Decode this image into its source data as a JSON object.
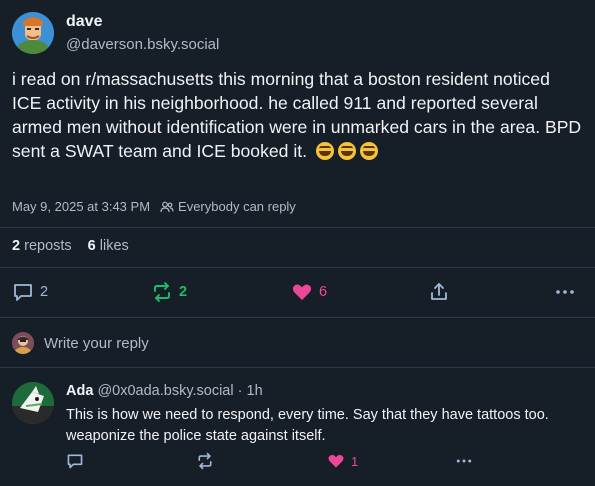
{
  "post": {
    "author_name": "dave",
    "author_handle": "@daverson.bsky.social",
    "text": "i read on r/massachusetts this morning that a boston resident noticed ICE activity in his neighborhood. he called 911 and reported several armed men without identification were in unmarked cars in the area. BPD sent a SWAT team and ICE booked it.",
    "emojis": [
      "rolling-on-floor-laughing",
      "rolling-on-floor-laughing",
      "rolling-on-floor-laughing"
    ],
    "timestamp": "May 9, 2025 at 3:43 PM",
    "reply_setting": "Everybody can reply",
    "reposts_count": "2",
    "reposts_label": "reposts",
    "likes_count": "6",
    "likes_label": "likes",
    "actions": {
      "reply_count": "2",
      "repost_count": "2",
      "like_count": "6"
    }
  },
  "reply_composer": {
    "placeholder": "Write your reply"
  },
  "comment": {
    "author_name": "Ada",
    "author_handle": "@0x0ada.bsky.social",
    "separator": "·",
    "age": "1h",
    "text": "This is how we need to respond, every time. Say that they have tattoos too. weaponize the police state against itself.",
    "actions": {
      "like_count": "1"
    }
  },
  "colors": {
    "background": "#161e27",
    "divider": "#2e3a48",
    "muted_text": "#aebbc9",
    "repost_green": "#20bc63",
    "like_pink": "#ec4899",
    "icon_blue": "#9fb9d9"
  },
  "icons": {
    "reply": "speech-bubble-icon",
    "repost": "repost-arrows-icon",
    "like": "heart-icon",
    "share": "share-icon",
    "more": "ellipsis-icon",
    "audience": "people-icon"
  }
}
